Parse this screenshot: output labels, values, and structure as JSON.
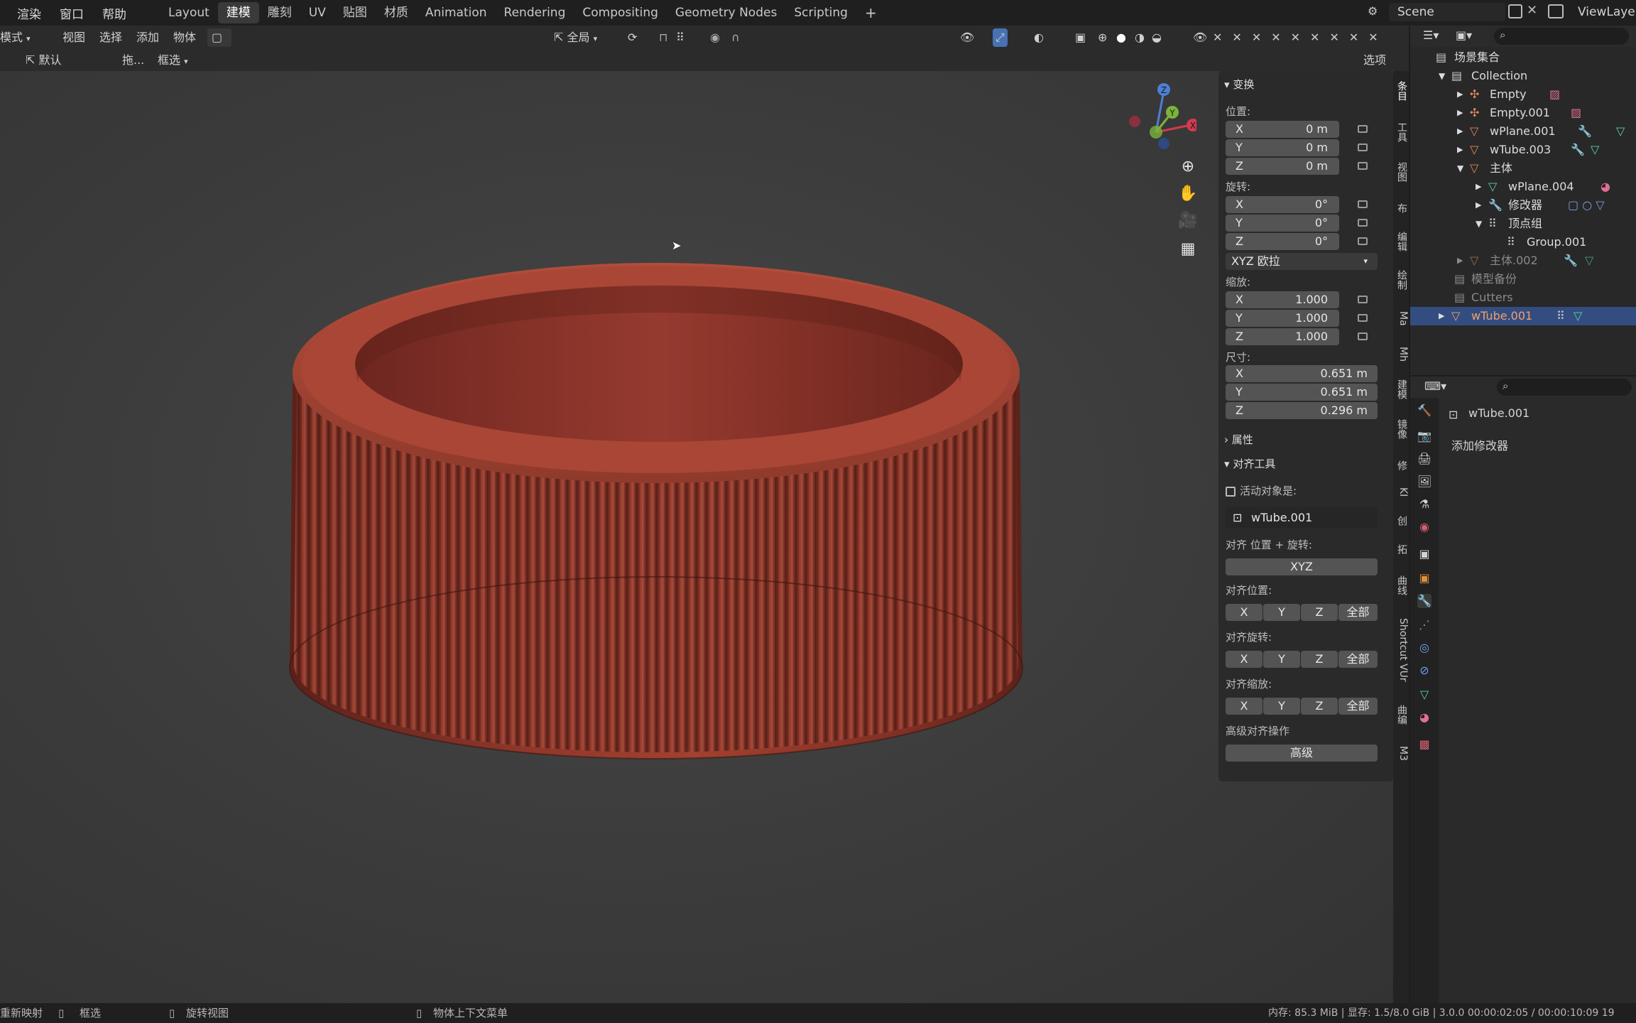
{
  "topbar": {
    "menus": [
      "渲染",
      "窗口",
      "帮助"
    ],
    "workspaces": [
      "Layout",
      "建模",
      "雕刻",
      "UV",
      "贴图",
      "材质",
      "Animation",
      "Rendering",
      "Compositing",
      "Geometry Nodes",
      "Scripting"
    ],
    "active_workspace": "建模",
    "add_tab": "+",
    "scene": "Scene",
    "view_layer": "ViewLayer"
  },
  "header": {
    "mode": "模式",
    "view": "视图",
    "select": "选择",
    "add": "添加",
    "object": "物体",
    "orientation": "全局",
    "brush": "默认",
    "drag": "拖...",
    "select_mode": "框选",
    "options": "选项"
  },
  "npanel": {
    "transform_title": "变换",
    "location_label": "位置:",
    "location": [
      {
        "axis": "X",
        "value": "0 m"
      },
      {
        "axis": "Y",
        "value": "0 m"
      },
      {
        "axis": "Z",
        "value": "0 m"
      }
    ],
    "rotation_label": "旋转:",
    "rotation": [
      {
        "axis": "X",
        "value": "0°"
      },
      {
        "axis": "Y",
        "value": "0°"
      },
      {
        "axis": "Z",
        "value": "0°"
      }
    ],
    "rotation_mode": "XYZ 欧拉",
    "scale_label": "缩放:",
    "scale": [
      {
        "axis": "X",
        "value": "1.000"
      },
      {
        "axis": "Y",
        "value": "1.000"
      },
      {
        "axis": "Z",
        "value": "1.000"
      }
    ],
    "dims_label": "尺寸:",
    "dims": [
      {
        "axis": "X",
        "value": "0.651 m"
      },
      {
        "axis": "Y",
        "value": "0.651 m"
      },
      {
        "axis": "Z",
        "value": "0.296 m"
      }
    ],
    "attributes_title": "属性",
    "align_title": "对齐工具",
    "active_obj_label": "活动对象是:",
    "active_obj": "wTube.001",
    "align_loc_rot_label": "对齐 位置 + 旋转:",
    "xyz_btn": "XYZ",
    "align_loc_label": "对齐位置:",
    "align_rot_label": "对齐旋转:",
    "align_scale_label": "对齐缩放:",
    "btn_x": "X",
    "btn_y": "Y",
    "btn_z": "Z",
    "btn_all": "全部",
    "adv_label": "高级对齐操作",
    "adv_btn": "高级"
  },
  "vtabs": [
    "条目",
    "工具",
    "视图",
    "布",
    "编辑",
    "绘制",
    "Ma",
    "Mh",
    "建模",
    "镜像",
    "修",
    "KI",
    "创",
    "拓",
    "曲线",
    "Shortcut VUr",
    "曲编",
    "M3"
  ],
  "outliner": {
    "root": "场景集合",
    "rows": [
      {
        "label": "Collection"
      },
      {
        "label": "Empty"
      },
      {
        "label": "Empty.001"
      },
      {
        "label": "wPlane.001"
      },
      {
        "label": "wTube.003"
      },
      {
        "label": "主体"
      },
      {
        "label": "wPlane.004"
      },
      {
        "label": "修改器"
      },
      {
        "label": "顶点组"
      },
      {
        "label": "Group.001"
      },
      {
        "label": "主体.002"
      },
      {
        "label": "模型备份"
      },
      {
        "label": "Cutters"
      },
      {
        "label": "wTube.001"
      }
    ]
  },
  "props": {
    "object_name": "wTube.001",
    "add_modifier": "添加修改器"
  },
  "status": {
    "left1": "重新映射",
    "left2": "框选",
    "left3": "旋转视图",
    "left4": "物体上下文菜单",
    "right": "内存: 85.3 MiB | 显存: 1.5/8.0 GiB | 3.0.0 00:00:02:05 / 00:00:10:09   19"
  },
  "colors": {
    "accent": "#4772b3",
    "object": "#a2412f",
    "selected_row": "#334d80"
  }
}
